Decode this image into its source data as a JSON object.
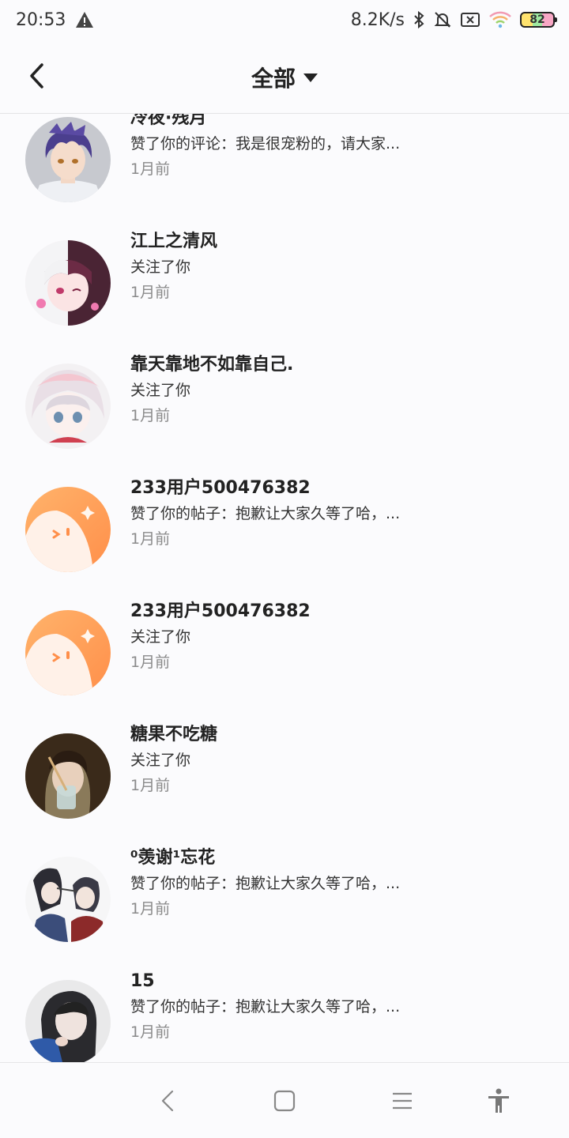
{
  "status_bar": {
    "time": "20:53",
    "net_speed": "8.2K/s",
    "battery_level": "82",
    "icons": [
      "warning-icon",
      "bluetooth-icon",
      "bell-muted-icon",
      "sim-off-icon",
      "wifi-icon",
      "battery-icon"
    ]
  },
  "header": {
    "title": "全部",
    "back_icon": "chevron-left-icon",
    "dropdown_icon": "caret-down-icon"
  },
  "notifications": [
    {
      "name": "冷夜·残月",
      "action": "赞了你的评论：我是很宠粉的，请大家...",
      "time": "1月前",
      "avatar": "anime-boy-purple-hair"
    },
    {
      "name": "江上之清风",
      "action": "关注了你",
      "time": "1月前",
      "avatar": "anime-girl-pink-white-hair"
    },
    {
      "name": "靠天靠地不如靠自己.",
      "action": "关注了你",
      "time": "1月前",
      "avatar": "anime-girl-silver-hair"
    },
    {
      "name": "233用户500476382",
      "action": "赞了你的帖子：抱歉让大家久等了哈，...",
      "time": "1月前",
      "avatar": "default-orange-avatar"
    },
    {
      "name": "233用户500476382",
      "action": "关注了你",
      "time": "1月前",
      "avatar": "default-orange-avatar"
    },
    {
      "name": "糖果不吃糖",
      "action": "关注了你",
      "time": "1月前",
      "avatar": "photo-girl-drink"
    },
    {
      "name": "⁰羡谢¹忘花",
      "action": "赞了你的帖子：抱歉让大家久等了哈，...",
      "time": "1月前",
      "avatar": "anime-couple"
    },
    {
      "name": "15",
      "action": "赞了你的帖子：抱歉让大家久等了哈，...",
      "time": "1月前",
      "avatar": "photo-girl-blue-sleeve"
    }
  ],
  "nav_bar": {
    "icons": [
      "nav-back-icon",
      "nav-home-icon",
      "nav-menu-icon",
      "accessibility-icon"
    ]
  }
}
